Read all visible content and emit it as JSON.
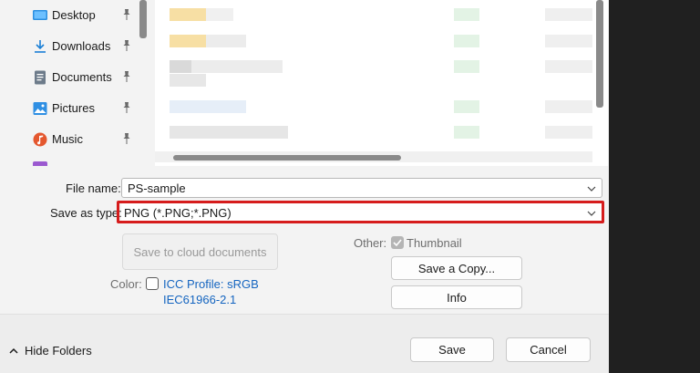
{
  "nav": {
    "items": [
      {
        "label": "Desktop",
        "icon": "desktop-icon",
        "color": "#2b8fe0"
      },
      {
        "label": "Downloads",
        "icon": "downloads-icon",
        "color": "#1a7fd6"
      },
      {
        "label": "Documents",
        "icon": "documents-icon",
        "color": "#6d7b8a"
      },
      {
        "label": "Pictures",
        "icon": "pictures-icon",
        "color": "#2f8fe3"
      },
      {
        "label": "Music",
        "icon": "music-icon",
        "color": "#e4572e"
      }
    ]
  },
  "form": {
    "file_name_label": "File name:",
    "file_name_value": "PS-sample",
    "save_type_label": "Save as type:",
    "save_type_value": "PNG (*.PNG;*.PNG)",
    "cloud_button": "Save to cloud documents",
    "other_label": "Other:",
    "thumbnail_label": "Thumbnail",
    "save_copy_button": "Save a Copy...",
    "info_button": "Info",
    "color_label": "Color:",
    "icc_line1": "ICC Profile:  sRGB",
    "icc_line2": "IEC61966-2.1"
  },
  "footer": {
    "hide_folders": "Hide Folders",
    "save_button": "Save",
    "cancel_button": "Cancel"
  },
  "colors": {
    "highlight": "#d61c1c",
    "link": "#1565c0"
  }
}
